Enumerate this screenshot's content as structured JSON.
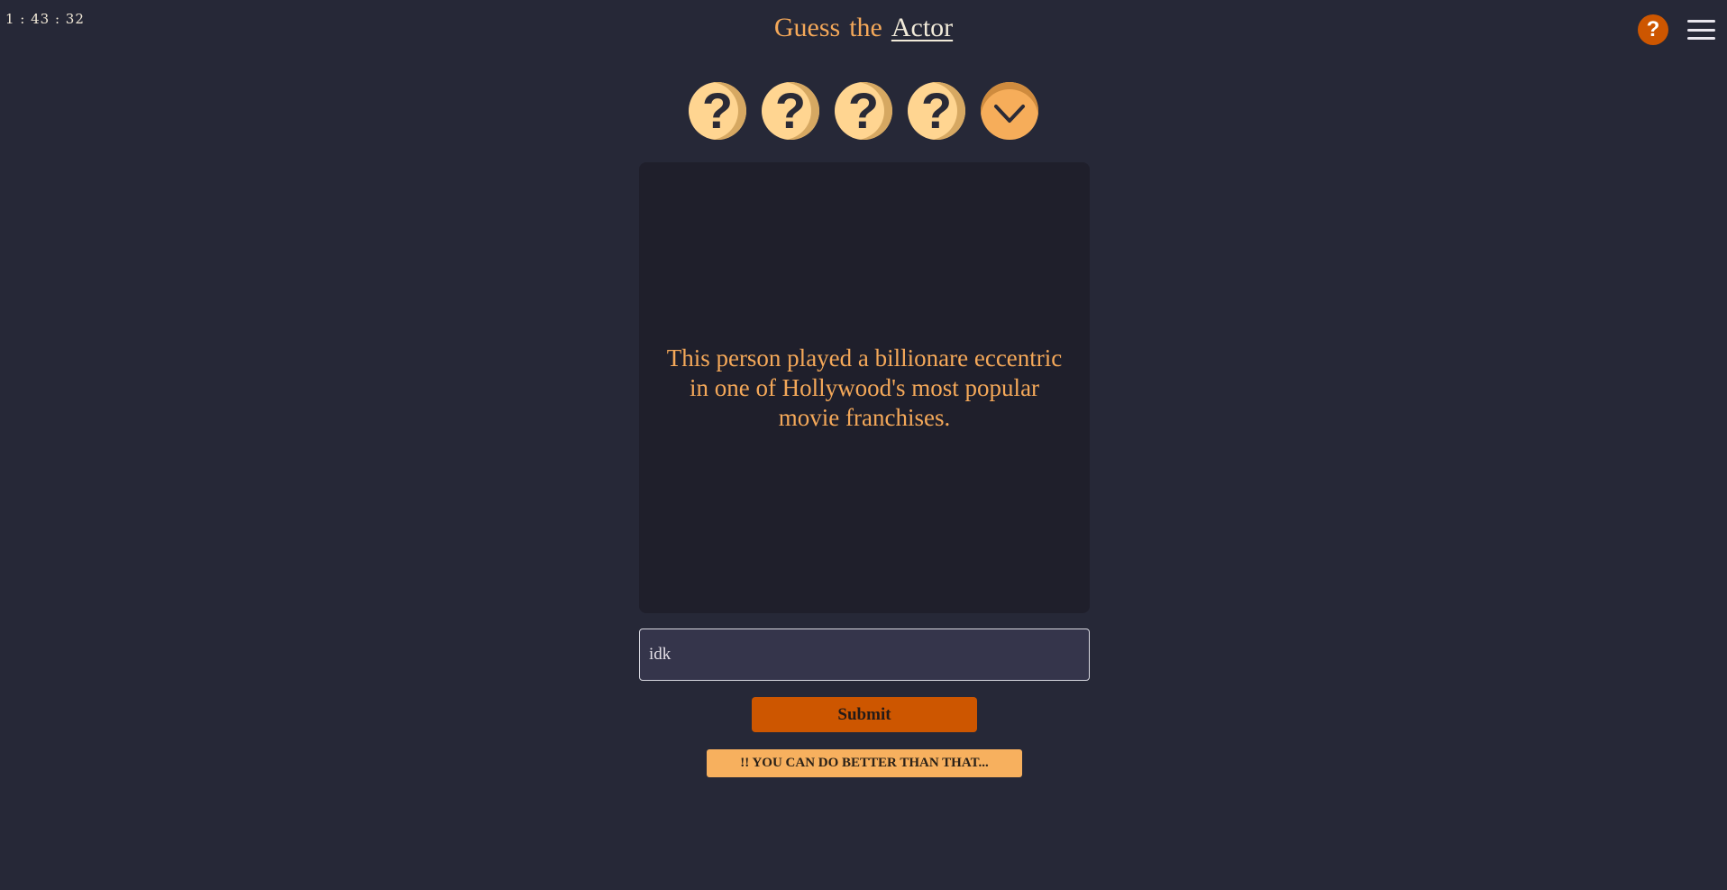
{
  "timer": "1 : 43 : 32",
  "header": {
    "title_prefix": [
      "Guess",
      "the"
    ],
    "title_accent": "Actor",
    "help_label": "?",
    "colors": {
      "accent": "#f4a859",
      "brand_orange": "#cd5600",
      "background": "#262837"
    }
  },
  "hints": [
    {
      "icon": "question-mark-icon",
      "label": "?"
    },
    {
      "icon": "question-mark-icon",
      "label": "?"
    },
    {
      "icon": "question-mark-icon",
      "label": "?"
    },
    {
      "icon": "question-mark-icon",
      "label": "?"
    },
    {
      "icon": "chevron-down-icon",
      "state": "active"
    }
  ],
  "clue_text": "This person played a billionare eccentric in one of Hollywood's most popular movie franchises.",
  "guess": {
    "value": "idk",
    "placeholder": ""
  },
  "submit_label": "Submit",
  "feedback_message": "!! YOU CAN DO BETTER THAN THAT..."
}
